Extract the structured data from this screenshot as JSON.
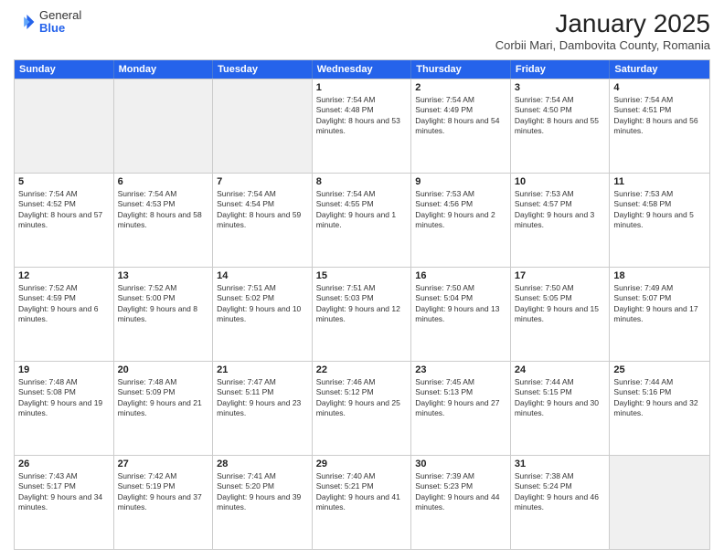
{
  "header": {
    "logo": {
      "general": "General",
      "blue": "Blue"
    },
    "title": "January 2025",
    "location": "Corbii Mari, Dambovita County, Romania"
  },
  "weekdays": [
    "Sunday",
    "Monday",
    "Tuesday",
    "Wednesday",
    "Thursday",
    "Friday",
    "Saturday"
  ],
  "rows": [
    [
      {
        "day": "",
        "empty": true
      },
      {
        "day": "",
        "empty": true
      },
      {
        "day": "",
        "empty": true
      },
      {
        "day": "1",
        "sunrise": "7:54 AM",
        "sunset": "4:48 PM",
        "daylight": "8 hours and 53 minutes."
      },
      {
        "day": "2",
        "sunrise": "7:54 AM",
        "sunset": "4:49 PM",
        "daylight": "8 hours and 54 minutes."
      },
      {
        "day": "3",
        "sunrise": "7:54 AM",
        "sunset": "4:50 PM",
        "daylight": "8 hours and 55 minutes."
      },
      {
        "day": "4",
        "sunrise": "7:54 AM",
        "sunset": "4:51 PM",
        "daylight": "8 hours and 56 minutes."
      }
    ],
    [
      {
        "day": "5",
        "sunrise": "7:54 AM",
        "sunset": "4:52 PM",
        "daylight": "8 hours and 57 minutes."
      },
      {
        "day": "6",
        "sunrise": "7:54 AM",
        "sunset": "4:53 PM",
        "daylight": "8 hours and 58 minutes."
      },
      {
        "day": "7",
        "sunrise": "7:54 AM",
        "sunset": "4:54 PM",
        "daylight": "8 hours and 59 minutes."
      },
      {
        "day": "8",
        "sunrise": "7:54 AM",
        "sunset": "4:55 PM",
        "daylight": "9 hours and 1 minute."
      },
      {
        "day": "9",
        "sunrise": "7:53 AM",
        "sunset": "4:56 PM",
        "daylight": "9 hours and 2 minutes."
      },
      {
        "day": "10",
        "sunrise": "7:53 AM",
        "sunset": "4:57 PM",
        "daylight": "9 hours and 3 minutes."
      },
      {
        "day": "11",
        "sunrise": "7:53 AM",
        "sunset": "4:58 PM",
        "daylight": "9 hours and 5 minutes."
      }
    ],
    [
      {
        "day": "12",
        "sunrise": "7:52 AM",
        "sunset": "4:59 PM",
        "daylight": "9 hours and 6 minutes."
      },
      {
        "day": "13",
        "sunrise": "7:52 AM",
        "sunset": "5:00 PM",
        "daylight": "9 hours and 8 minutes."
      },
      {
        "day": "14",
        "sunrise": "7:51 AM",
        "sunset": "5:02 PM",
        "daylight": "9 hours and 10 minutes."
      },
      {
        "day": "15",
        "sunrise": "7:51 AM",
        "sunset": "5:03 PM",
        "daylight": "9 hours and 12 minutes."
      },
      {
        "day": "16",
        "sunrise": "7:50 AM",
        "sunset": "5:04 PM",
        "daylight": "9 hours and 13 minutes."
      },
      {
        "day": "17",
        "sunrise": "7:50 AM",
        "sunset": "5:05 PM",
        "daylight": "9 hours and 15 minutes."
      },
      {
        "day": "18",
        "sunrise": "7:49 AM",
        "sunset": "5:07 PM",
        "daylight": "9 hours and 17 minutes."
      }
    ],
    [
      {
        "day": "19",
        "sunrise": "7:48 AM",
        "sunset": "5:08 PM",
        "daylight": "9 hours and 19 minutes."
      },
      {
        "day": "20",
        "sunrise": "7:48 AM",
        "sunset": "5:09 PM",
        "daylight": "9 hours and 21 minutes."
      },
      {
        "day": "21",
        "sunrise": "7:47 AM",
        "sunset": "5:11 PM",
        "daylight": "9 hours and 23 minutes."
      },
      {
        "day": "22",
        "sunrise": "7:46 AM",
        "sunset": "5:12 PM",
        "daylight": "9 hours and 25 minutes."
      },
      {
        "day": "23",
        "sunrise": "7:45 AM",
        "sunset": "5:13 PM",
        "daylight": "9 hours and 27 minutes."
      },
      {
        "day": "24",
        "sunrise": "7:44 AM",
        "sunset": "5:15 PM",
        "daylight": "9 hours and 30 minutes."
      },
      {
        "day": "25",
        "sunrise": "7:44 AM",
        "sunset": "5:16 PM",
        "daylight": "9 hours and 32 minutes."
      }
    ],
    [
      {
        "day": "26",
        "sunrise": "7:43 AM",
        "sunset": "5:17 PM",
        "daylight": "9 hours and 34 minutes."
      },
      {
        "day": "27",
        "sunrise": "7:42 AM",
        "sunset": "5:19 PM",
        "daylight": "9 hours and 37 minutes."
      },
      {
        "day": "28",
        "sunrise": "7:41 AM",
        "sunset": "5:20 PM",
        "daylight": "9 hours and 39 minutes."
      },
      {
        "day": "29",
        "sunrise": "7:40 AM",
        "sunset": "5:21 PM",
        "daylight": "9 hours and 41 minutes."
      },
      {
        "day": "30",
        "sunrise": "7:39 AM",
        "sunset": "5:23 PM",
        "daylight": "9 hours and 44 minutes."
      },
      {
        "day": "31",
        "sunrise": "7:38 AM",
        "sunset": "5:24 PM",
        "daylight": "9 hours and 46 minutes."
      },
      {
        "day": "",
        "empty": true
      }
    ]
  ]
}
